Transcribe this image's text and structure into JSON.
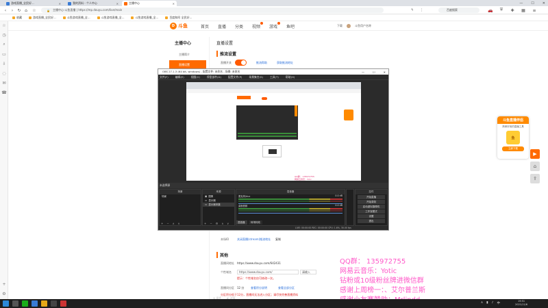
{
  "browser": {
    "tabs": [
      {
        "label": "游戏直播_全民好...",
        "active": false
      },
      {
        "label": "我的资料 - 个人中心",
        "active": false
      },
      {
        "label": "主播中心",
        "active": true
      }
    ],
    "url": "主播中心-斗鱼直播 | https://mp.douyu.com/live/main",
    "url_dim": "",
    "search": "百度搜索",
    "window_controls": [
      "—",
      "☐",
      "✕"
    ]
  },
  "bookmarks": [
    "收藏",
    "游戏直播_全民好...",
    "斗鱼游戏直播_全...",
    "斗鱼游戏直播_全...",
    "斗鱼游戏直播_全...",
    "百度和阿 全民好..."
  ],
  "site": {
    "logo": "斗鱼",
    "nav": [
      "首页",
      "直播",
      "分类",
      "视频",
      "游戏",
      "鱼吧"
    ],
    "header_right": [
      "下载",
      "斗鱼用户名称"
    ],
    "side_title": "主播中心",
    "side_items": [
      "主播简介",
      "直播设置"
    ],
    "panel_title": "直播设置",
    "sections": {
      "stream_title": "推流设置",
      "toggle_label": "直播开关",
      "toggle_links": [
        "推流帮助",
        "获取推流地址"
      ],
      "other_title": "其他",
      "rows": [
        {
          "label": "本场ID",
          "value": "关闭直播(stream)推流地址",
          "extra": "复制"
        },
        {
          "label": "直播间地址",
          "value": "https://www.douyu.com/642431"
        },
        {
          "label": "个性域名",
          "value": "https://www.douyu.com/",
          "input": "请输入",
          "hint": "提示：个性域名仅可修改一次。"
        },
        {
          "label": "直播间分区",
          "value": "12 分",
          "links": [
            "查看积分说明",
            "查看全部分区"
          ],
          "note": "分区积分低于12分，直播间无法进入分区；请尽快完善直播资料"
        }
      ]
    }
  },
  "promo": {
    "title": "斗鱼直播伴侣",
    "subtitle": "简单好用的直播工具",
    "button": "立即下载"
  },
  "obs": {
    "title": "OBS 27.1.3 (64 bit, windows) - 配置文件: 未命名 - 场景: 未命名",
    "menu": [
      "文件(F)",
      "编辑(E)",
      "视图(V)",
      "停靠部件(D)",
      "配置文件(P)",
      "场景集合(S)",
      "工具(T)",
      "帮助(H)"
    ],
    "status": "未选择源",
    "preview_controls": [
      "属性",
      "滤镜"
    ],
    "docks": {
      "scenes": {
        "header": "场景",
        "items": [
          "场景"
        ]
      },
      "sources": {
        "header": "来源",
        "items": [
          "图像",
          "显示器",
          "显示器采集"
        ]
      },
      "mixer": {
        "header": "混音器",
        "items": [
          "麦克风/Aux",
          "桌面音频"
        ],
        "levels": [
          "0.0 dB",
          "0.0 dB"
        ]
      },
      "transitions": {
        "header": "转场特效"
      },
      "controls": {
        "header": "控件",
        "buttons": [
          "开始直播",
          "开始录制",
          "启动虚拟摄像机",
          "工作室模式",
          "设置",
          "退出"
        ]
      }
    },
    "tabs": [
      "混音器",
      "转场特效"
    ],
    "footer_stats": "LIVE: 00:00:00  REC: 00:00:00  CPU: 1.6%, 30.00 fps"
  },
  "overlay_lines": [
    "QQ群：  135972755",
    "网易云音乐：Yotic",
    "钻粉或10级粉丝牌进微信群",
    "感谢上周榜一：、艾尔普兰斯",
    "感谢小友赛赞助：Mrlindd"
  ],
  "taskbar": {
    "clock": "19:51",
    "date": "2021/11/6"
  },
  "colors": {
    "brand": "#ff6a00",
    "overlay": "#ff58c8",
    "obs_bg": "#2b2b2b",
    "link": "#2a6fdb"
  }
}
